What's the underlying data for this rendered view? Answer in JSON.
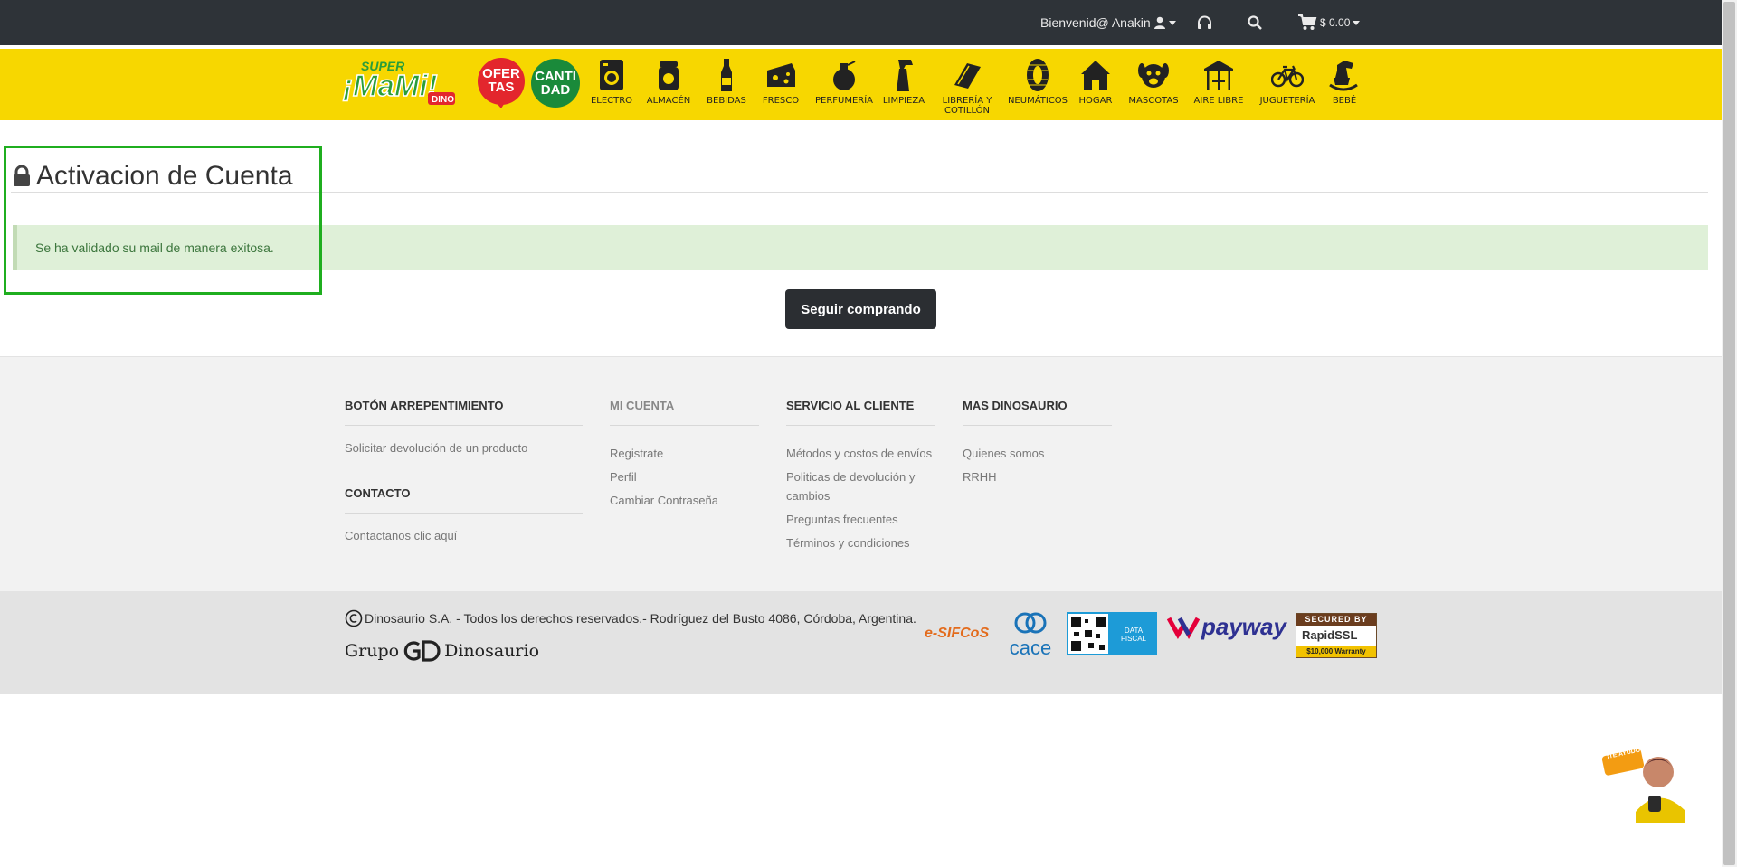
{
  "topbar": {
    "welcome": "Bienvenid@ Anakin",
    "cart_total": "$ 0.00"
  },
  "nav": {
    "logo_super": "SUPER",
    "logo_mami": "¡MaMi!",
    "logo_dino": "DINO",
    "ofertas": "OFER TAS",
    "cantidad": "CANTI DAD",
    "categories": [
      {
        "label": "ELECTRO",
        "icon": "washing-machine-icon"
      },
      {
        "label": "ALMACÉN",
        "icon": "jar-icon"
      },
      {
        "label": "BEBIDAS",
        "icon": "bottle-icon"
      },
      {
        "label": "FRESCO",
        "icon": "cheese-icon"
      },
      {
        "label": "PERFUMERÍA",
        "icon": "perfume-icon"
      },
      {
        "label": "LIMPIEZA",
        "icon": "spray-icon"
      },
      {
        "label": "LIBRERÍA Y COTILLÓN",
        "icon": "book-icon"
      },
      {
        "label": "NEUMÁTICOS",
        "icon": "tire-icon"
      },
      {
        "label": "HOGAR",
        "icon": "house-icon"
      },
      {
        "label": "MASCOTAS",
        "icon": "dog-icon"
      },
      {
        "label": "AIRE LIBRE",
        "icon": "gazebo-icon"
      },
      {
        "label": "JUGUETERÍA",
        "icon": "bicycle-icon"
      },
      {
        "label": "BEBÉ",
        "icon": "rocking-horse-icon"
      }
    ]
  },
  "main": {
    "title": "Activacion de Cuenta",
    "success_message": "Se ha validado su mail de manera exitosa.",
    "continue_button": "Seguir comprando"
  },
  "footer": {
    "col1": {
      "heading": "BOTÓN ARREPENTIMIENTO",
      "link": "Solicitar devolución de un producto",
      "heading2": "CONTACTO",
      "link2": "Contactanos clic aquí"
    },
    "col2": {
      "heading": "MI CUENTA",
      "links": [
        "Registrate",
        "Perfil",
        "Cambiar Contraseña"
      ]
    },
    "col3": {
      "heading": "SERVICIO AL CLIENTE",
      "links": [
        "Métodos y costos de envíos",
        "Politicas de devolución y cambios",
        "Preguntas frecuentes",
        "Términos y condiciones"
      ]
    },
    "col4": {
      "heading": "MAS DINOSAURIO",
      "links": [
        "Quienes somos",
        "RRHH"
      ]
    },
    "copyright": "Dinosaurio S.A. - Todos los derechos reservados.- Rodríguez del Busto 4086, Córdoba, Argentina.",
    "grupo_left": "Grupo",
    "grupo_right": "Dinosaurio",
    "badges": {
      "sifcos": "e-SIFCoS",
      "cace": "cace",
      "datafiscal": "DATA FISCAL",
      "payway": "payway",
      "ssl_top": "SECURED BY",
      "ssl_mid": "RapidSSL",
      "ssl_bottom": "$10,000 Warranty"
    }
  },
  "helper": {
    "bubble": "¡TE AYUDO!"
  },
  "colors": {
    "topbar": "#2e3338",
    "nav_yellow": "#f7d700",
    "success_bg": "#dff0d8",
    "success_text": "#3c763d",
    "highlight": "#1fae1f",
    "button": "#2b2e32"
  }
}
